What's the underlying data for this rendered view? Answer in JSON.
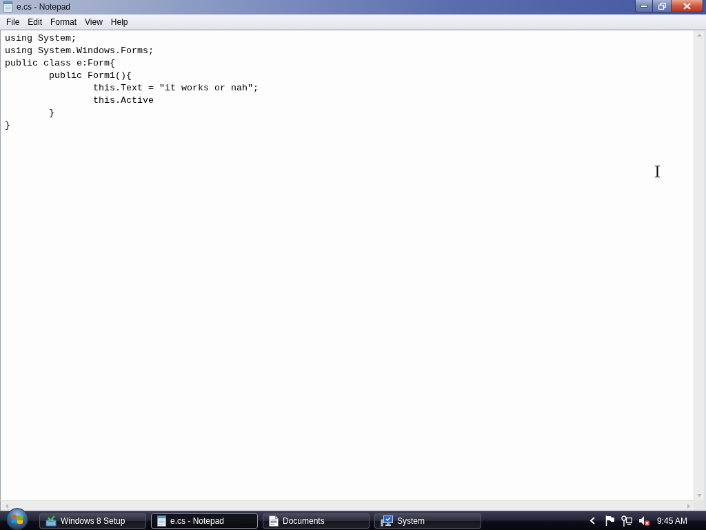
{
  "window": {
    "title": "e.cs - Notepad"
  },
  "menu_bar": [
    {
      "label": "File"
    },
    {
      "label": "Edit"
    },
    {
      "label": "Format"
    },
    {
      "label": "View"
    },
    {
      "label": "Help"
    }
  ],
  "editor": {
    "lines": [
      "using System;",
      "using System.Windows.Forms;",
      "public class e:Form{",
      "\tpublic Form1(){",
      "\t\tthis.Text = \"it works or nah\";",
      "\t\tthis.Active",
      "\t}",
      "}"
    ]
  },
  "taskbar": {
    "items": [
      {
        "label": "Windows 8 Setup",
        "kind": "setup",
        "selected": false
      },
      {
        "label": "e.cs - Notepad",
        "kind": "notepad",
        "selected": true
      },
      {
        "label": "Documents",
        "kind": "documents",
        "selected": false
      },
      {
        "label": "System",
        "kind": "system",
        "selected": false
      }
    ],
    "clock": "9:45 AM"
  }
}
